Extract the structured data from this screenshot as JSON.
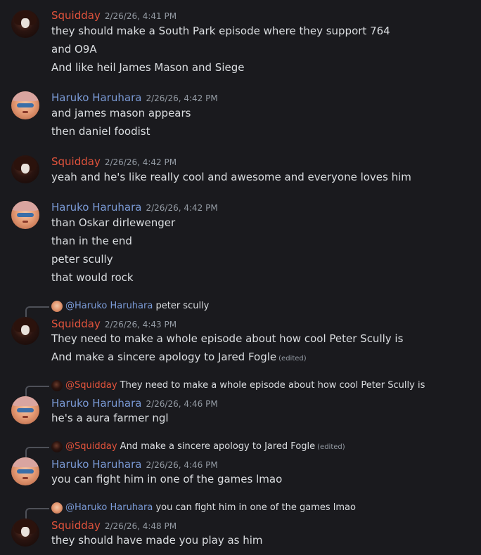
{
  "messages": [
    {
      "author": "Squidday",
      "timestamp": "2/26/26, 4:41 PM",
      "lines": [
        "they should make a South Park episode where they support 764",
        "and O9A",
        "And like heil James Mason and Siege"
      ]
    },
    {
      "author": "Haruko Haruhara",
      "timestamp": "2/26/26, 4:42 PM",
      "lines": [
        "and james mason appears",
        "then daniel foodist"
      ]
    },
    {
      "author": "Squidday",
      "timestamp": "2/26/26, 4:42 PM",
      "lines": [
        "yeah and he's like really cool and awesome and everyone loves him"
      ]
    },
    {
      "author": "Haruko Haruhara",
      "timestamp": "2/26/26, 4:42 PM",
      "lines": [
        "than Oskar dirlewenger",
        "than in the end",
        "peter scully",
        "that would rock"
      ]
    },
    {
      "author": "Squidday",
      "timestamp": "2/26/26, 4:43 PM",
      "reply": {
        "mention": "@Haruko Haruhara",
        "text": "peter scully"
      },
      "lines": [
        "They need to make a whole episode about how cool Peter Scully is",
        "And make a sincere apology to Jared Fogle"
      ],
      "edited": "(edited)"
    },
    {
      "author": "Haruko Haruhara",
      "timestamp": "2/26/26, 4:46 PM",
      "reply": {
        "mention": "@Squidday",
        "text": "They need to make a whole episode about how cool Peter Scully is"
      },
      "lines": [
        "he's a aura farmer ngl"
      ]
    },
    {
      "author": "Haruko Haruhara",
      "timestamp": "2/26/26, 4:46 PM",
      "reply": {
        "mention": "@Squidday",
        "text": "And make a sincere apology to Jared Fogle",
        "edited": "(edited)"
      },
      "lines": [
        "you can fight him in one of the games lmao"
      ]
    },
    {
      "author": "Squidday",
      "timestamp": "2/26/26, 4:48 PM",
      "reply": {
        "mention": "@Haruko Haruhara",
        "text": "you can fight him in one of the games lmao"
      },
      "lines": [
        "they should have made you play as him"
      ]
    }
  ],
  "colors": {
    "background": "#1a1a1e",
    "squidday": "#e2533c",
    "haruko": "#7a9ad6",
    "text": "#dbdee1",
    "muted": "#949ba4"
  }
}
